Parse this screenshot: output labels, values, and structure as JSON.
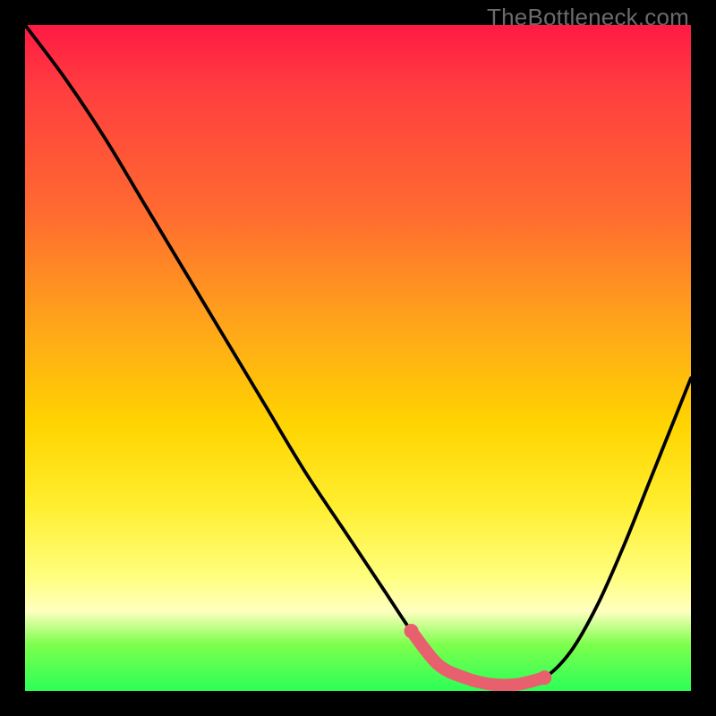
{
  "watermark": "TheBottleneck.com",
  "chart_data": {
    "type": "line",
    "title": "",
    "xlabel": "",
    "ylabel": "",
    "xlim": [
      0,
      100
    ],
    "ylim": [
      0,
      100
    ],
    "grid": false,
    "legend": false,
    "background": "red-yellow-green vertical gradient",
    "series": [
      {
        "name": "bottleneck-curve",
        "x": [
          0,
          6,
          12,
          18,
          24,
          30,
          36,
          42,
          48,
          54,
          58,
          62,
          66,
          70,
          74,
          78,
          82,
          86,
          90,
          94,
          98,
          100
        ],
        "y": [
          100,
          92,
          83,
          73,
          63,
          53,
          43,
          33,
          24,
          15,
          9,
          4,
          2,
          1,
          1,
          2,
          6,
          13,
          22,
          32,
          42,
          47
        ]
      },
      {
        "name": "optimal-region-band",
        "x": [
          58,
          62,
          66,
          70,
          74,
          78
        ],
        "y": [
          9,
          4,
          2,
          1,
          1,
          2
        ],
        "style": "thick-pink"
      }
    ],
    "markers": [
      {
        "name": "optimal-start-dot",
        "x": 58,
        "y": 9
      },
      {
        "name": "optimal-end-dot",
        "x": 78,
        "y": 2
      }
    ]
  }
}
